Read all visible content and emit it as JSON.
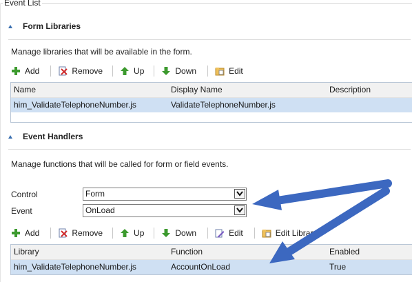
{
  "event_list": {
    "title": "Event List"
  },
  "form_libraries": {
    "heading": "Form Libraries",
    "description": "Manage libraries that will be available in the form.",
    "toolbar": {
      "add": "Add",
      "remove": "Remove",
      "up": "Up",
      "down": "Down",
      "edit": "Edit"
    },
    "columns": [
      "Name",
      "Display Name",
      "Description"
    ],
    "rows": [
      [
        "him_ValidateTelephoneNumber.js",
        "ValidateTelephoneNumber.js",
        ""
      ]
    ]
  },
  "event_handlers": {
    "heading": "Event Handlers",
    "description": "Manage functions that will be called for form or field events.",
    "control_label": "Control",
    "control_value": "Form",
    "event_label": "Event",
    "event_value": "OnLoad",
    "toolbar": {
      "add": "Add",
      "remove": "Remove",
      "up": "Up",
      "down": "Down",
      "edit": "Edit",
      "edit_library": "Edit Library"
    },
    "columns": [
      "Library",
      "Function",
      "Enabled"
    ],
    "rows": [
      [
        "him_ValidateTelephoneNumber.js",
        "AccountOnLoad",
        "True"
      ]
    ]
  },
  "colors": {
    "accent": "#3a6fb0",
    "selected_row": "#cfe0f3",
    "annotation_arrow": "#4a78c6"
  }
}
